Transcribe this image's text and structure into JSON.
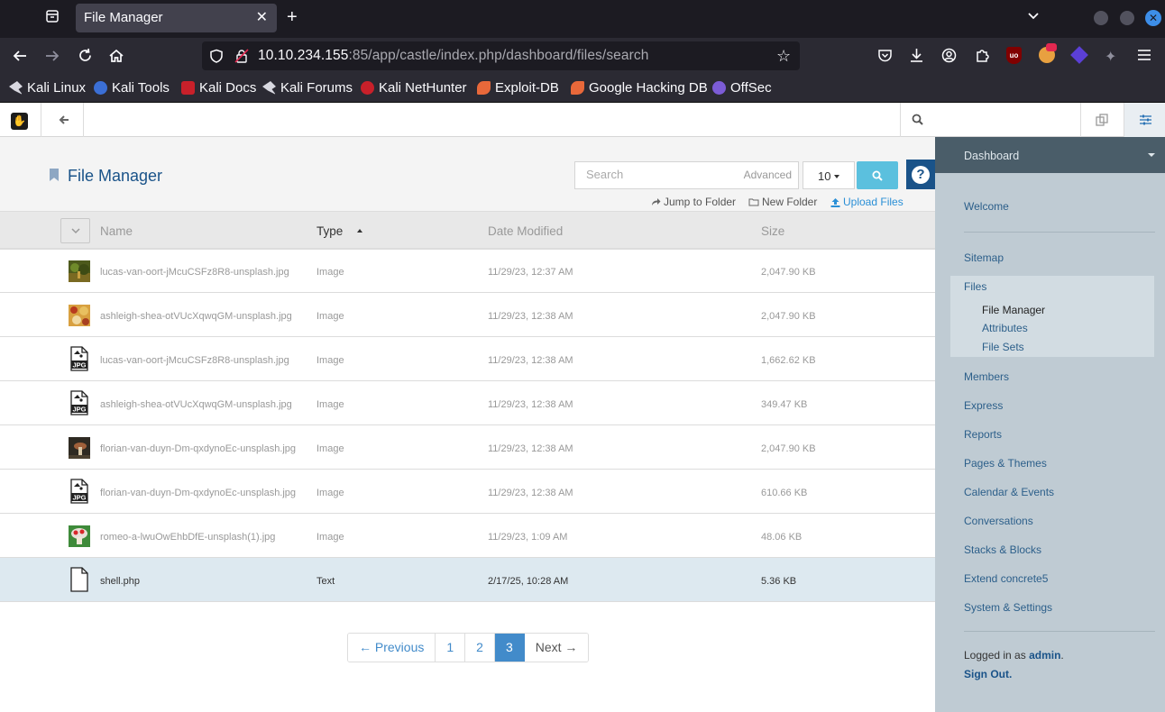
{
  "browser": {
    "tab_title": "File Manager",
    "url_host": "10.10.234.155",
    "url_rest": ":85/app/castle/index.php/dashboard/files/search",
    "bookmarks": [
      {
        "label": "Kali Linux",
        "color": "#d8d8e0"
      },
      {
        "label": "Kali Tools",
        "color": "#e8333b"
      },
      {
        "label": "Kali Docs",
        "color": "#c8202a"
      },
      {
        "label": "Kali Forums",
        "color": "#d8d8e0"
      },
      {
        "label": "Kali NetHunter",
        "color": "#c8202a"
      },
      {
        "label": "Exploit-DB",
        "color": "#e8683a"
      },
      {
        "label": "Google Hacking DB",
        "color": "#e8683a"
      },
      {
        "label": "OffSec",
        "color": "#7c5cd6"
      }
    ]
  },
  "header": {
    "title": "File Manager",
    "search_placeholder": "Search",
    "advanced_label": "Advanced",
    "per_page": "10",
    "jump_label": "Jump to Folder",
    "new_folder_label": "New Folder",
    "upload_label": "Upload Files"
  },
  "table": {
    "columns": [
      "Name",
      "Type",
      "Date Modified",
      "Size"
    ],
    "sort_column": "Type",
    "rows": [
      {
        "name": "lucas-van-oort-jMcuCSFz8R8-unsplash.jpg",
        "type": "Image",
        "date": "11/29/23, 12:37 AM",
        "size": "2,047.90 KB",
        "icon": "thumbnail-forest"
      },
      {
        "name": "ashleigh-shea-otVUcXqwqGM-unsplash.jpg",
        "type": "Image",
        "date": "11/29/23, 12:38 AM",
        "size": "2,047.90 KB",
        "icon": "thumbnail-autumn"
      },
      {
        "name": "lucas-van-oort-jMcuCSFz8R8-unsplash.jpg",
        "type": "Image",
        "date": "11/29/23, 12:38 AM",
        "size": "1,662.62 KB",
        "icon": "jpg-file-icon"
      },
      {
        "name": "ashleigh-shea-otVUcXqwqGM-unsplash.jpg",
        "type": "Image",
        "date": "11/29/23, 12:38 AM",
        "size": "349.47 KB",
        "icon": "jpg-file-icon"
      },
      {
        "name": "florian-van-duyn-Dm-qxdynoEc-unsplash.jpg",
        "type": "Image",
        "date": "11/29/23, 12:38 AM",
        "size": "2,047.90 KB",
        "icon": "thumbnail-mushroom"
      },
      {
        "name": "florian-van-duyn-Dm-qxdynoEc-unsplash.jpg",
        "type": "Image",
        "date": "11/29/23, 12:38 AM",
        "size": "610.66 KB",
        "icon": "jpg-file-icon"
      },
      {
        "name": "romeo-a-lwuOwEhbDfE-unsplash(1).jpg",
        "type": "Image",
        "date": "11/29/23, 1:09 AM",
        "size": "48.06 KB",
        "icon": "thumbnail-toad"
      },
      {
        "name": "shell.php",
        "type": "Text",
        "date": "2/17/25, 10:28 AM",
        "size": "5.36 KB",
        "icon": "text-file-icon",
        "selected": true
      }
    ]
  },
  "pagination": {
    "previous": "← Previous",
    "pages": [
      "1",
      "2",
      "3"
    ],
    "current": "3",
    "next": "Next →"
  },
  "panel": {
    "title": "Dashboard",
    "welcome": "Welcome",
    "sitemap": "Sitemap",
    "files": "Files",
    "files_sub": [
      "File Manager",
      "Attributes",
      "File Sets"
    ],
    "items": [
      "Members",
      "Express",
      "Reports",
      "Pages & Themes",
      "Calendar & Events",
      "Conversations",
      "Stacks & Blocks",
      "Extend concrete5",
      "System & Settings"
    ],
    "logged_prefix": "Logged in as",
    "user": "admin",
    "signout": "Sign Out."
  }
}
